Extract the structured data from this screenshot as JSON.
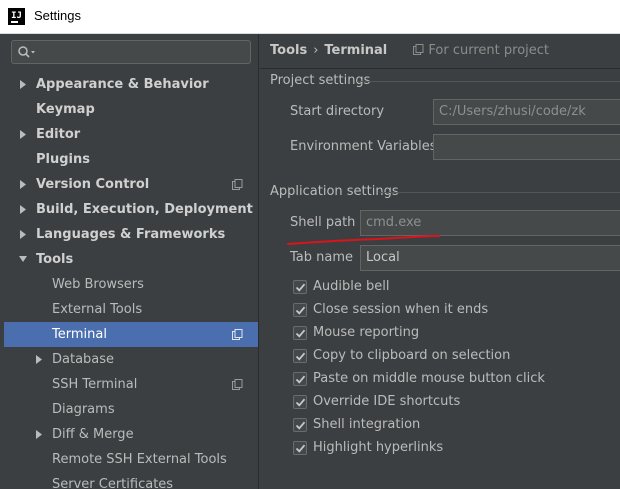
{
  "window": {
    "title": "Settings"
  },
  "sidebar": {
    "search": {
      "placeholder": ""
    },
    "items": [
      {
        "label": "Appearance & Behavior",
        "level": 0,
        "bold": true,
        "arrow": "right",
        "copy": false,
        "selected": false
      },
      {
        "label": "Keymap",
        "level": 0,
        "bold": true,
        "arrow": "none",
        "copy": false,
        "selected": false
      },
      {
        "label": "Editor",
        "level": 0,
        "bold": true,
        "arrow": "right",
        "copy": false,
        "selected": false
      },
      {
        "label": "Plugins",
        "level": 0,
        "bold": true,
        "arrow": "none",
        "copy": false,
        "selected": false
      },
      {
        "label": "Version Control",
        "level": 0,
        "bold": true,
        "arrow": "right",
        "copy": true,
        "selected": false
      },
      {
        "label": "Build, Execution, Deployment",
        "level": 0,
        "bold": true,
        "arrow": "right",
        "copy": false,
        "selected": false
      },
      {
        "label": "Languages & Frameworks",
        "level": 0,
        "bold": true,
        "arrow": "right",
        "copy": false,
        "selected": false
      },
      {
        "label": "Tools",
        "level": 0,
        "bold": true,
        "arrow": "down",
        "copy": false,
        "selected": false
      },
      {
        "label": "Web Browsers",
        "level": 1,
        "bold": false,
        "arrow": "none",
        "copy": false,
        "selected": false
      },
      {
        "label": "External Tools",
        "level": 1,
        "bold": false,
        "arrow": "none",
        "copy": false,
        "selected": false
      },
      {
        "label": "Terminal",
        "level": 1,
        "bold": false,
        "arrow": "none",
        "copy": true,
        "selected": true
      },
      {
        "label": "Database",
        "level": 1,
        "bold": false,
        "arrow": "right",
        "copy": false,
        "selected": false
      },
      {
        "label": "SSH Terminal",
        "level": 1,
        "bold": false,
        "arrow": "none",
        "copy": true,
        "selected": false
      },
      {
        "label": "Diagrams",
        "level": 1,
        "bold": false,
        "arrow": "none",
        "copy": false,
        "selected": false
      },
      {
        "label": "Diff & Merge",
        "level": 1,
        "bold": false,
        "arrow": "right",
        "copy": false,
        "selected": false
      },
      {
        "label": "Remote SSH External Tools",
        "level": 1,
        "bold": false,
        "arrow": "none",
        "copy": false,
        "selected": false
      },
      {
        "label": "Server Certificates",
        "level": 1,
        "bold": false,
        "arrow": "none",
        "copy": false,
        "selected": false
      }
    ]
  },
  "breadcrumb": {
    "parent": "Tools",
    "separator": "›",
    "current": "Terminal",
    "scope": "For current project"
  },
  "project_settings": {
    "title": "Project settings",
    "start_directory": {
      "label": "Start directory",
      "value": "C:/Users/zhusi/code/zk"
    },
    "environment_variables": {
      "label": "Environment Variables",
      "value": ""
    }
  },
  "app_settings": {
    "title": "Application settings",
    "shell_path": {
      "label": "Shell path",
      "value": "cmd.exe"
    },
    "tab_name": {
      "label": "Tab name",
      "value": "Local"
    },
    "checkboxes": [
      {
        "label": "Audible bell",
        "checked": true
      },
      {
        "label": "Close session when it ends",
        "checked": true
      },
      {
        "label": "Mouse reporting",
        "checked": true
      },
      {
        "label": "Copy to clipboard on selection",
        "checked": true
      },
      {
        "label": "Paste on middle mouse button click",
        "checked": true
      },
      {
        "label": "Override IDE shortcuts",
        "checked": true
      },
      {
        "label": "Shell integration",
        "checked": true
      },
      {
        "label": "Highlight hyperlinks",
        "checked": true
      }
    ]
  },
  "colors": {
    "background": "#3c3f41",
    "selection": "#4b6eaf",
    "annotation": "#d9141a"
  }
}
